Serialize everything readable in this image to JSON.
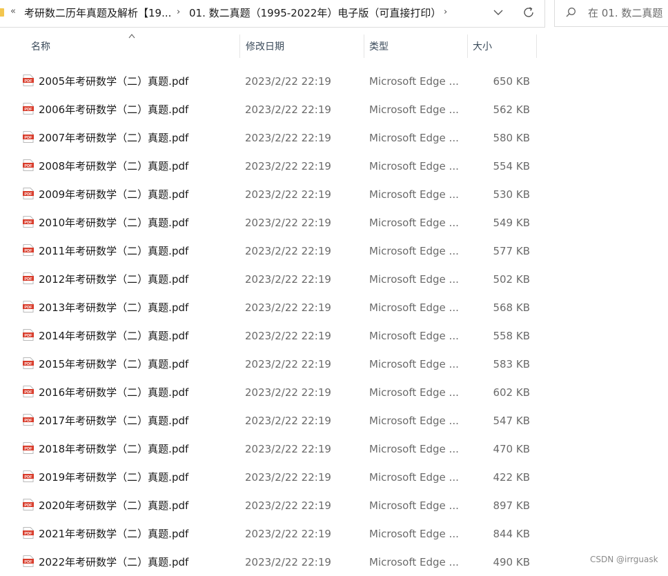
{
  "breadcrumb": {
    "overflow": "«",
    "parent": "考研数二历年真题及解析【19...",
    "separator": "›",
    "current": "01. 数二真题（1995-2022年）电子版（可直接打印）",
    "trailing_separator": "›"
  },
  "search": {
    "placeholder": "在 01. 数二真题"
  },
  "columns": {
    "name": "名称",
    "date": "修改日期",
    "type": "类型",
    "size": "大小"
  },
  "files": [
    {
      "name": "2005年考研数学（二）真题.pdf",
      "date": "2023/2/22 22:19",
      "type": "Microsoft Edge ...",
      "size": "650 KB"
    },
    {
      "name": "2006年考研数学（二）真题.pdf",
      "date": "2023/2/22 22:19",
      "type": "Microsoft Edge ...",
      "size": "562 KB"
    },
    {
      "name": "2007年考研数学（二）真题.pdf",
      "date": "2023/2/22 22:19",
      "type": "Microsoft Edge ...",
      "size": "580 KB"
    },
    {
      "name": "2008年考研数学（二）真题.pdf",
      "date": "2023/2/22 22:19",
      "type": "Microsoft Edge ...",
      "size": "554 KB"
    },
    {
      "name": "2009年考研数学（二）真题.pdf",
      "date": "2023/2/22 22:19",
      "type": "Microsoft Edge ...",
      "size": "530 KB"
    },
    {
      "name": "2010年考研数学（二）真题.pdf",
      "date": "2023/2/22 22:19",
      "type": "Microsoft Edge ...",
      "size": "549 KB"
    },
    {
      "name": "2011年考研数学（二）真题.pdf",
      "date": "2023/2/22 22:19",
      "type": "Microsoft Edge ...",
      "size": "577 KB"
    },
    {
      "name": "2012年考研数学（二）真题.pdf",
      "date": "2023/2/22 22:19",
      "type": "Microsoft Edge ...",
      "size": "502 KB"
    },
    {
      "name": "2013年考研数学（二）真题.pdf",
      "date": "2023/2/22 22:19",
      "type": "Microsoft Edge ...",
      "size": "568 KB"
    },
    {
      "name": "2014年考研数学（二）真题.pdf",
      "date": "2023/2/22 22:19",
      "type": "Microsoft Edge ...",
      "size": "558 KB"
    },
    {
      "name": "2015年考研数学（二）真题.pdf",
      "date": "2023/2/22 22:19",
      "type": "Microsoft Edge ...",
      "size": "583 KB"
    },
    {
      "name": "2016年考研数学（二）真题.pdf",
      "date": "2023/2/22 22:19",
      "type": "Microsoft Edge ...",
      "size": "602 KB"
    },
    {
      "name": "2017年考研数学（二）真题.pdf",
      "date": "2023/2/22 22:19",
      "type": "Microsoft Edge ...",
      "size": "547 KB"
    },
    {
      "name": "2018年考研数学（二）真题.pdf",
      "date": "2023/2/22 22:19",
      "type": "Microsoft Edge ...",
      "size": "470 KB"
    },
    {
      "name": "2019年考研数学（二）真题.pdf",
      "date": "2023/2/22 22:19",
      "type": "Microsoft Edge ...",
      "size": "422 KB"
    },
    {
      "name": "2020年考研数学（二）真题.pdf",
      "date": "2023/2/22 22:19",
      "type": "Microsoft Edge ...",
      "size": "897 KB"
    },
    {
      "name": "2021年考研数学（二）真题.pdf",
      "date": "2023/2/22 22:19",
      "type": "Microsoft Edge ...",
      "size": "844 KB"
    },
    {
      "name": "2022年考研数学（二）真题.pdf",
      "date": "2023/2/22 22:19",
      "type": "Microsoft Edge ...",
      "size": "490 KB"
    }
  ],
  "icons": {
    "folder": "folder-icon",
    "chevron": "chevron-down-icon",
    "refresh": "refresh-icon",
    "search": "search-icon",
    "file": "pdf-file-icon",
    "sort": "sort-ascending-icon"
  },
  "colors": {
    "pdf_red": "#d83b2a",
    "folder_yellow": "#f3c64f",
    "header_text": "#3a4a5a"
  },
  "watermark": "CSDN @irrguask"
}
